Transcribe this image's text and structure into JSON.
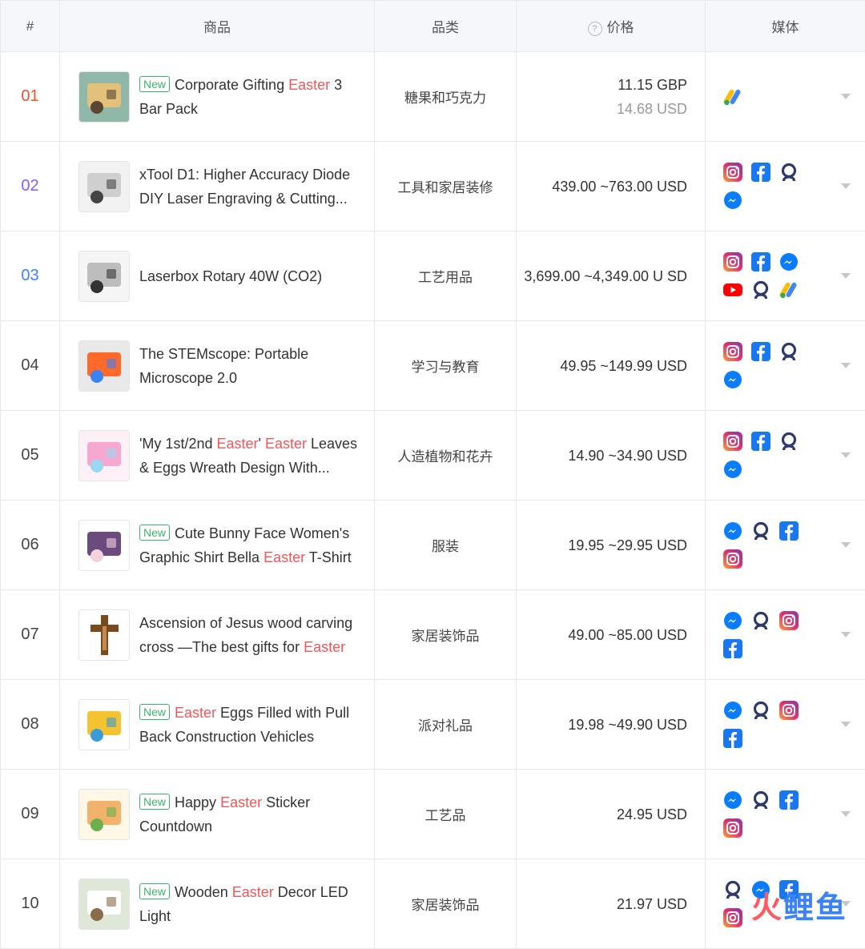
{
  "header": {
    "rank": "#",
    "product": "商品",
    "category": "品类",
    "price": "价格",
    "media": "媒体"
  },
  "colors": {
    "new_tag": "#3db36b",
    "highlight": "#f0575b",
    "rank_1": "#e8532f",
    "rank_2": "#8a5cf6",
    "rank_3": "#3b82f6"
  },
  "rows": [
    {
      "rank": "01",
      "is_new": true,
      "new_label": "New",
      "title": [
        {
          "t": "Corporate Gifting "
        },
        {
          "t": "Easter",
          "hl": true
        },
        {
          "t": " 3 Bar Pack"
        }
      ],
      "category": "糖果和巧克力",
      "price": "11.15 GBP",
      "price_sub": "14.68 USD",
      "media": [
        "google-ads-icon"
      ]
    },
    {
      "rank": "02",
      "is_new": false,
      "new_label": "",
      "title": [
        {
          "t": "xTool D1: Higher Accuracy Diode DIY Laser Engraving & Cutting..."
        }
      ],
      "category": "工具和家居装修",
      "price": "439.00 ~763.00 USD",
      "price_sub": "",
      "media": [
        "instagram-icon",
        "facebook-icon",
        "audience-network-icon",
        "messenger-icon"
      ]
    },
    {
      "rank": "03",
      "is_new": false,
      "new_label": "",
      "title": [
        {
          "t": "Laserbox Rotary 40W (CO2)"
        }
      ],
      "category": "工艺用品",
      "price": "3,699.00 ~4,349.00 U SD",
      "price_sub": "",
      "media": [
        "instagram-icon",
        "facebook-icon",
        "messenger-icon",
        "youtube-icon",
        "audience-network-icon",
        "google-ads-icon"
      ]
    },
    {
      "rank": "04",
      "is_new": false,
      "new_label": "",
      "title": [
        {
          "t": "The STEMscope: Portable Microscope 2.0"
        }
      ],
      "category": "学习与教育",
      "price": "49.95 ~149.99 USD",
      "price_sub": "",
      "media": [
        "instagram-icon",
        "facebook-icon",
        "audience-network-icon",
        "messenger-icon"
      ]
    },
    {
      "rank": "05",
      "is_new": false,
      "new_label": "",
      "title": [
        {
          "t": "'My 1st/2nd "
        },
        {
          "t": "Easter",
          "hl": true
        },
        {
          "t": "' "
        },
        {
          "t": "Easter",
          "hl": true
        },
        {
          "t": " Leaves & Eggs Wreath Design With..."
        }
      ],
      "category": "人造植物和花卉",
      "price": "14.90 ~34.90 USD",
      "price_sub": "",
      "media": [
        "instagram-icon",
        "facebook-icon",
        "audience-network-icon",
        "messenger-icon"
      ]
    },
    {
      "rank": "06",
      "is_new": true,
      "new_label": "New",
      "title": [
        {
          "t": "Cute Bunny Face Women's Graphic Shirt Bella "
        },
        {
          "t": "Easter",
          "hl": true
        },
        {
          "t": " T-Shirt"
        }
      ],
      "category": "服装",
      "price": "19.95 ~29.95 USD",
      "price_sub": "",
      "media": [
        "messenger-icon",
        "audience-network-icon",
        "facebook-icon",
        "instagram-icon"
      ]
    },
    {
      "rank": "07",
      "is_new": false,
      "new_label": "",
      "title": [
        {
          "t": "Ascension of Jesus wood carving cross —The best gifts for "
        },
        {
          "t": "Easter",
          "hl": true
        }
      ],
      "category": "家居装饰品",
      "price": "49.00 ~85.00 USD",
      "price_sub": "",
      "media": [
        "messenger-icon",
        "audience-network-icon",
        "instagram-icon",
        "facebook-icon"
      ]
    },
    {
      "rank": "08",
      "is_new": true,
      "new_label": "New",
      "title": [
        {
          "t": "Easter",
          "hl": true
        },
        {
          "t": " Eggs Filled with Pull Back Construction Vehicles"
        }
      ],
      "category": "派对礼品",
      "price": "19.98 ~49.90 USD",
      "price_sub": "",
      "media": [
        "messenger-icon",
        "audience-network-icon",
        "instagram-icon",
        "facebook-icon"
      ]
    },
    {
      "rank": "09",
      "is_new": true,
      "new_label": "New",
      "title": [
        {
          "t": "Happy "
        },
        {
          "t": "Easter",
          "hl": true
        },
        {
          "t": " Sticker Countdown"
        }
      ],
      "category": "工艺品",
      "price": "24.95 USD",
      "price_sub": "",
      "media": [
        "messenger-icon",
        "audience-network-icon",
        "facebook-icon",
        "instagram-icon"
      ]
    },
    {
      "rank": "10",
      "is_new": true,
      "new_label": "New",
      "title": [
        {
          "t": "Wooden "
        },
        {
          "t": "Easter",
          "hl": true
        },
        {
          "t": " Decor LED Light"
        }
      ],
      "category": "家居装饰品",
      "price": "21.97 USD",
      "price_sub": "",
      "media": [
        "audience-network-icon",
        "messenger-icon",
        "facebook-icon",
        "instagram-icon"
      ]
    }
  ],
  "watermark": {
    "part1": "火",
    "part2": "鲤鱼"
  }
}
